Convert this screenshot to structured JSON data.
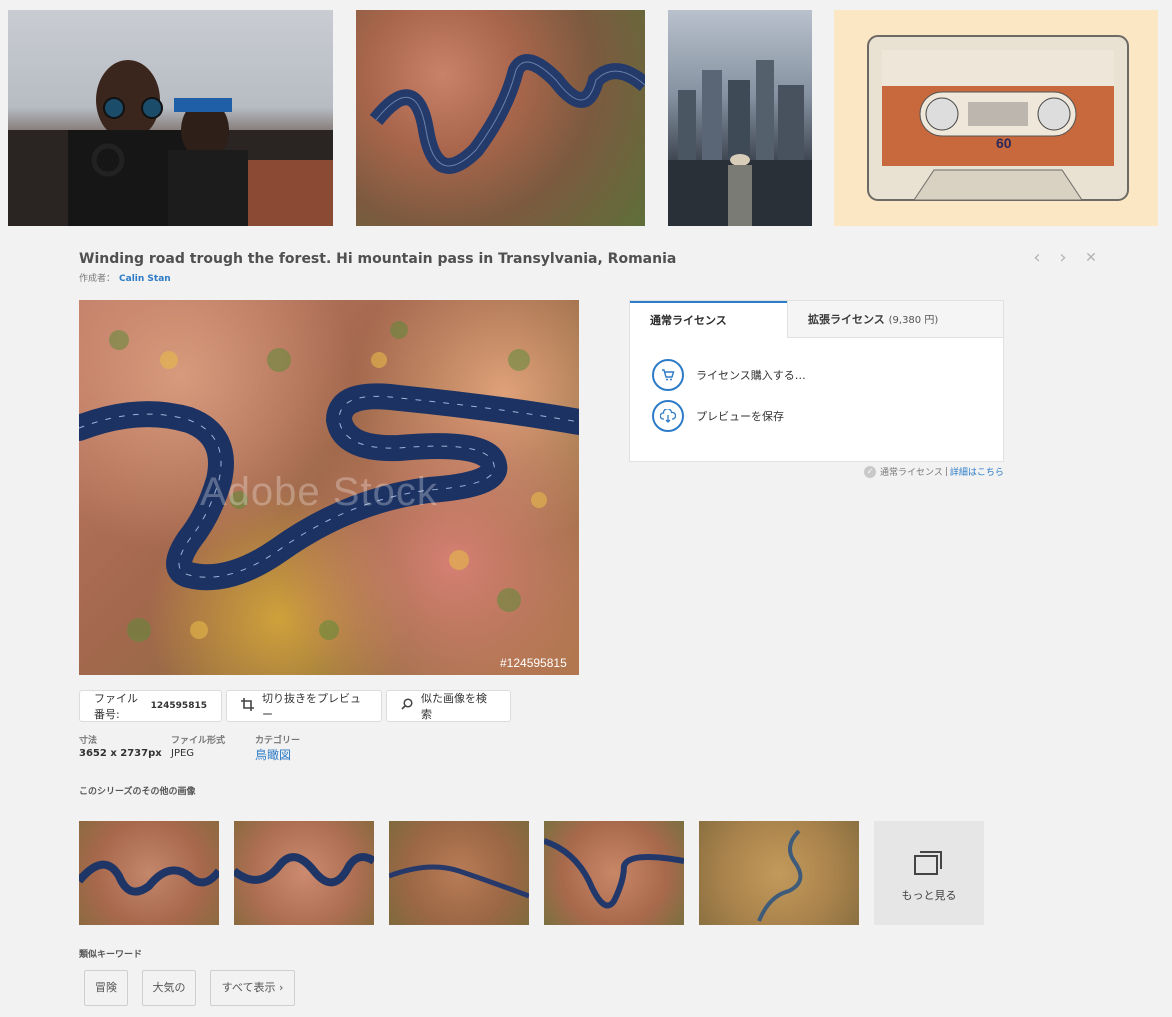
{
  "header": {
    "title": "Winding road trough the forest. Hi mountain pass in Transylvania, Romania",
    "author_label": "作成者：",
    "author": "Calin Stan"
  },
  "nav": {
    "prev": "‹",
    "next": "›",
    "close": "✕"
  },
  "image": {
    "watermark": "Adobe Stock",
    "id_label": "#124595815"
  },
  "license": {
    "tab_standard": "通常ライセンス",
    "tab_extended": "拡張ライセンス",
    "tab_extended_price": "(9,380 円)",
    "buy_label": "ライセンス購入する…",
    "save_preview_label": "プレビューを保存",
    "note": "通常ライセンス",
    "note_sep": "|",
    "note_link": "詳細はこちら"
  },
  "actions": {
    "file_no_label": "ファイル番号:",
    "file_no_value": "124595815",
    "crop_label": "切り抜きをプレビュー",
    "similar_label": "似た画像を検索"
  },
  "meta": {
    "size_label": "寸法",
    "size_value": "3652 x 2737px",
    "format_label": "ファイル形式",
    "format_value": "JPEG",
    "category_label": "カテゴリー",
    "category_value": "鳥瞰図"
  },
  "series": {
    "heading": "このシリーズのその他の画像",
    "more_label": "もっと見る"
  },
  "keywords": {
    "heading": "類似キーワード",
    "items": [
      "冒険",
      "大気の",
      "すべて表示 ›"
    ]
  }
}
